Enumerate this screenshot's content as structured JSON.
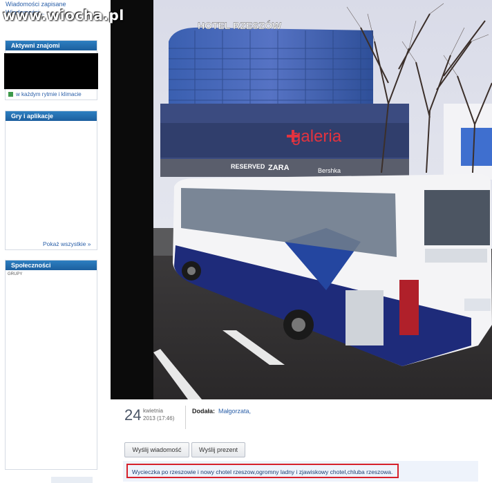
{
  "watermark": "www.wiocha.pl",
  "sidebar": {
    "top_links": [
      "Wiadomości zapisane",
      "Wiadomości..."
    ],
    "friends_header": "Aktywni znajomi",
    "friends_item": "w każdym rytmie i klimacie",
    "games_header": "Gry i aplikacje",
    "show_all": "Pokaż wszystkie »",
    "communities_header": "Społeczności",
    "groups_label": "GRUPY"
  },
  "photo": {
    "hotel_sign": "HOTEL RZESZÓW",
    "mall_sign": "galeria",
    "store_signs": [
      "RESERVED",
      "ZARA",
      "Bershka"
    ]
  },
  "post": {
    "day": "24",
    "month": "kwietnia",
    "year_time": "2013 (17:46)",
    "added_label": "Dodała:",
    "added_name": "Małgorzata,",
    "send_message": "Wyślij wiadomość",
    "send_gift": "Wyślij prezent",
    "description": "Wycieczka po rzeszowie i nowy chotel rzeszow,ogromny ladny i zjawiskowy chotel,chluba rzeszowa."
  },
  "colors": {
    "header_blue": "#1f6aad",
    "link_blue": "#2a5fa8",
    "highlight_red": "#d6202a"
  }
}
